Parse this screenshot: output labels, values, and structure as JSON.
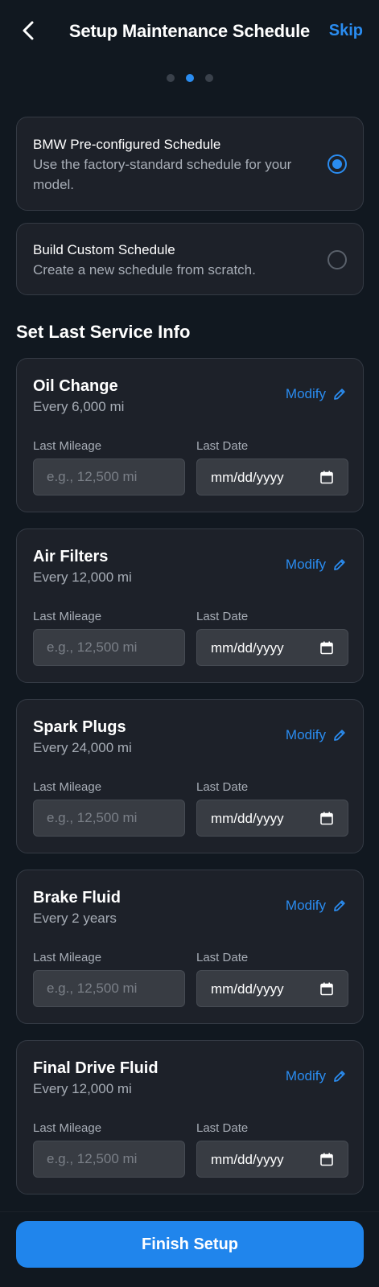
{
  "header": {
    "title": "Setup Maintenance Schedule",
    "skip_label": "Skip",
    "steps": 3,
    "active_step": 2
  },
  "options": [
    {
      "title": "BMW Pre-configured Schedule",
      "description": "Use the factory-standard schedule for your model.",
      "selected": true
    },
    {
      "title": "Build Custom Schedule",
      "description": "Create a new schedule from scratch.",
      "selected": false
    }
  ],
  "section_title": "Set Last Service Info",
  "services": [
    {
      "name": "Oil Change",
      "interval": "Every 6,000 mi",
      "modify_label": "Modify",
      "mileage_label": "Last Mileage",
      "mileage_placeholder": "e.g., 12,500 mi",
      "date_label": "Last Date",
      "date_placeholder": "mm/dd/yyyy"
    },
    {
      "name": "Air Filters",
      "interval": "Every 12,000 mi",
      "modify_label": "Modify",
      "mileage_label": "Last Mileage",
      "mileage_placeholder": "e.g., 12,500 mi",
      "date_label": "Last Date",
      "date_placeholder": "mm/dd/yyyy"
    },
    {
      "name": "Spark Plugs",
      "interval": "Every 24,000 mi",
      "modify_label": "Modify",
      "mileage_label": "Last Mileage",
      "mileage_placeholder": "e.g., 12,500 mi",
      "date_label": "Last Date",
      "date_placeholder": "mm/dd/yyyy"
    },
    {
      "name": "Brake Fluid",
      "interval": "Every 2 years",
      "modify_label": "Modify",
      "mileage_label": "Last Mileage",
      "mileage_placeholder": "e.g., 12,500 mi",
      "date_label": "Last Date",
      "date_placeholder": "mm/dd/yyyy"
    },
    {
      "name": "Final Drive Fluid",
      "interval": "Every 12,000 mi",
      "modify_label": "Modify",
      "mileage_label": "Last Mileage",
      "mileage_placeholder": "e.g., 12,500 mi",
      "date_label": "Last Date",
      "date_placeholder": "mm/dd/yyyy"
    }
  ],
  "footer": {
    "finish_label": "Finish Setup"
  },
  "colors": {
    "background": "#111820",
    "card": "#1d2129",
    "accent": "#2a8cf0",
    "muted_text": "#a7adb6"
  },
  "icons": {
    "back": "chevron-left-icon",
    "modify": "pencil-icon",
    "date": "calendar-icon"
  }
}
